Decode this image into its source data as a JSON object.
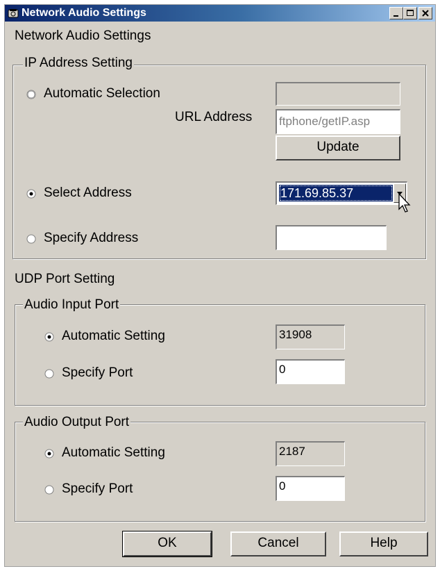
{
  "window": {
    "title": "Network Audio Settings",
    "heading": "Network Audio Settings"
  },
  "ip_group": {
    "legend": "IP Address Setting",
    "automatic_label": "Automatic Selection",
    "automatic_value": "",
    "url_label": "URL Address",
    "url_value": "ftphone/getIP.asp",
    "update_label": "Update",
    "select_label": "Select Address",
    "select_value": "171.69.85.37",
    "specify_label": "Specify Address",
    "specify_value": "",
    "selected": "select"
  },
  "udp": {
    "heading": "UDP Port Setting",
    "input": {
      "legend": "Audio Input Port",
      "auto_label": "Automatic Setting",
      "auto_value": "31908",
      "specify_label": "Specify Port",
      "specify_value": "0",
      "selected": "auto"
    },
    "output": {
      "legend": "Audio Output Port",
      "auto_label": "Automatic Setting",
      "auto_value": "2187",
      "specify_label": "Specify Port",
      "specify_value": "0",
      "selected": "auto"
    }
  },
  "buttons": {
    "ok": "OK",
    "cancel": "Cancel",
    "help": "Help"
  },
  "colors": {
    "face": "#d4d0c8",
    "titlebar_start": "#0a246a",
    "selection": "#0a246a"
  },
  "icons": [
    "phone-icon",
    "minimize-icon",
    "maximize-icon",
    "close-icon",
    "radio-icon",
    "dropdown-arrow-icon",
    "mouse-cursor-icon"
  ]
}
